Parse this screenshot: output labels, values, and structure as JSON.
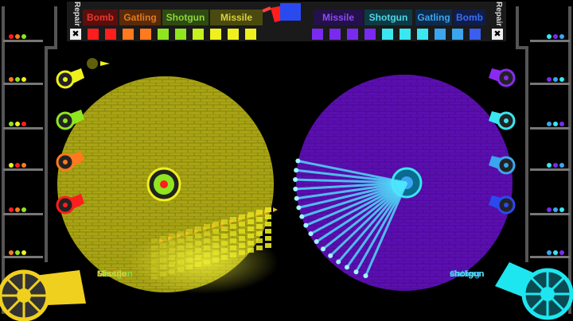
{
  "top_bar": {
    "left_weapons": [
      {
        "label": "Bomb",
        "color": "#e23b2e",
        "bg": "#5a0e0e"
      },
      {
        "label": "Gatling",
        "color": "#e07a1e",
        "bg": "#5a2a0a"
      },
      {
        "label": "Shotgun",
        "color": "#8fd63a",
        "bg": "#2f4a12"
      },
      {
        "label": "Missile",
        "color": "#d9d23a",
        "bg": "#4a4a10"
      }
    ],
    "right_weapons": [
      {
        "label": "Missile",
        "color": "#8a4cf0",
        "bg": "#24104a"
      },
      {
        "label": "Shotgun",
        "color": "#4fd6e6",
        "bg": "#0e3a44"
      },
      {
        "label": "Gatling",
        "color": "#3aa6f0",
        "bg": "#0e2a4a"
      },
      {
        "label": "Bomb",
        "color": "#3a6ef0",
        "bg": "#101c4a"
      }
    ],
    "repair_left": "Repair",
    "repair_right": "Repair",
    "left_squares": [
      "#ff1e1e",
      "#ff1e1e",
      "#ff7a1e",
      "#ff7a1e",
      "#8fe61e",
      "#8fe61e",
      "#c6f01e",
      "#f0f01e",
      "#f0f01e",
      "#f0f01e"
    ],
    "right_squares": [
      "#7a2af0",
      "#7a2af0",
      "#7a2af0",
      "#7a2af0",
      "#3ae6f0",
      "#3ae6f0",
      "#3ae6f0",
      "#3aa6f0",
      "#3aa6f0",
      "#3a5ef0"
    ]
  },
  "left_player": {
    "color": "#a8a414",
    "weapon_queue": [
      "Gatling",
      "Shotgun",
      "Shotgun",
      "Missile"
    ],
    "queue_colors": [
      "#e07a1e",
      "#8fd63a",
      "#8fd63a",
      "#d9d23a"
    ]
  },
  "right_player": {
    "color": "#5b0fb0",
    "weapon_queue": [
      "shotgun",
      "Gatling",
      "shotgun",
      "shotgun"
    ],
    "queue_colors": [
      "#4fd6e6",
      "#3aa6f0",
      "#4fd6e6",
      "#4fd6e6"
    ]
  },
  "left_turrets": [
    "#f0f01e",
    "#8fe61e",
    "#ff7a1e",
    "#ff1e1e"
  ],
  "right_turrets": [
    "#8a2af0",
    "#3ae6f0",
    "#3aa6f0",
    "#2a4af0"
  ]
}
